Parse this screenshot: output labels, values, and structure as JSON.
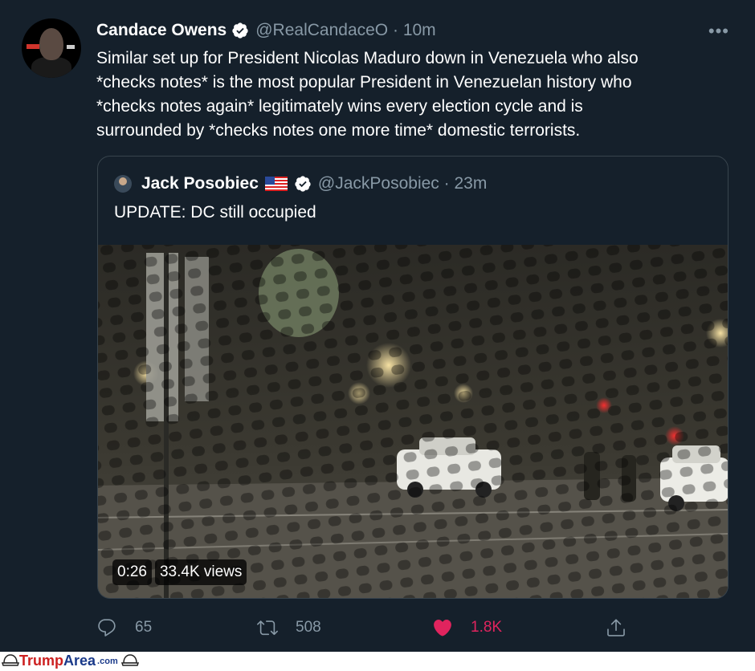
{
  "tweet": {
    "author": {
      "name": "Candace Owens",
      "handle": "@RealCandaceO",
      "time": "10m",
      "verified": true
    },
    "more_icon": "more-horizontal-icon",
    "text_lines": [
      "Similar set up for President Nicolas Maduro down in Venezuela who also",
      "*checks notes* is the most popular President in Venezuelan history who",
      "*checks notes again* legitimately wins every election cycle and is",
      "surrounded by *checks notes one more time* domestic terrorists."
    ],
    "quote": {
      "author": {
        "name": "Jack Posobiec",
        "handle": "@JackPosobiec",
        "time": "23m",
        "verified": true,
        "flag": "us-flag-icon"
      },
      "text": "UPDATE: DC still occupied",
      "video": {
        "duration": "0:26",
        "views": "33.4K views"
      }
    },
    "actions": {
      "reply": {
        "icon": "reply-icon",
        "count": "65"
      },
      "retweet": {
        "icon": "retweet-icon",
        "count": "508"
      },
      "like": {
        "icon": "heart-icon",
        "count": "1.8K",
        "color": "#e0245e"
      },
      "share": {
        "icon": "share-icon"
      }
    }
  },
  "watermark": {
    "site_a": "Trump",
    "site_b": "Area",
    "tld": ".com"
  },
  "colors": {
    "background": "#15202b",
    "secondary_text": "#8899a6",
    "border": "#38444d",
    "verified": "#ffffff",
    "like": "#e0245e"
  }
}
